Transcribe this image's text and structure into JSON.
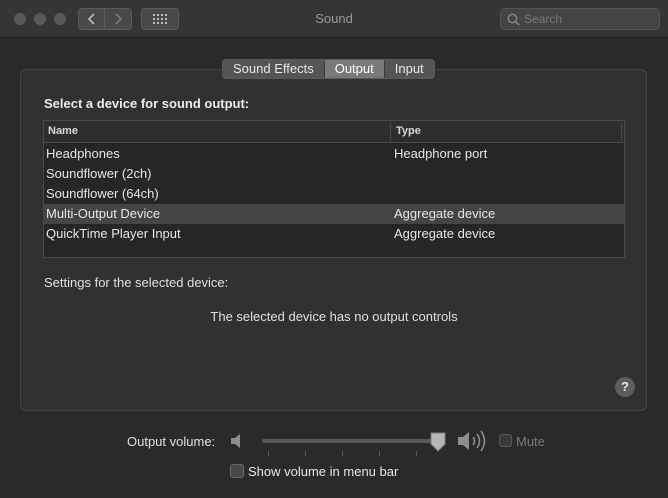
{
  "window": {
    "title": "Sound",
    "search_placeholder": "Search"
  },
  "tabs": [
    {
      "label": "Sound Effects",
      "active": false
    },
    {
      "label": "Output",
      "active": true
    },
    {
      "label": "Input",
      "active": false
    }
  ],
  "output": {
    "heading": "Select a device for sound output:",
    "columns": {
      "name": "Name",
      "type": "Type"
    },
    "devices": [
      {
        "name": "Headphones",
        "type": "Headphone port",
        "selected": false
      },
      {
        "name": "Soundflower (2ch)",
        "type": "",
        "selected": false
      },
      {
        "name": "Soundflower (64ch)",
        "type": "",
        "selected": false
      },
      {
        "name": "Multi-Output Device",
        "type": "Aggregate device",
        "selected": true
      },
      {
        "name": "QuickTime Player Input",
        "type": "Aggregate device",
        "selected": false
      }
    ],
    "settings_label": "Settings for the selected device:",
    "no_controls": "The selected device has no output controls",
    "help": "?"
  },
  "volume": {
    "label": "Output volume:",
    "level": 1.0,
    "mute_label": "Mute",
    "mute_checked": false,
    "mute_enabled": false,
    "show_in_menu_label": "Show volume in menu bar",
    "show_in_menu_checked": false
  },
  "colors": {
    "background": "#2b2a2b",
    "selected_row": "#464546",
    "active_tab": "#7a797a"
  }
}
